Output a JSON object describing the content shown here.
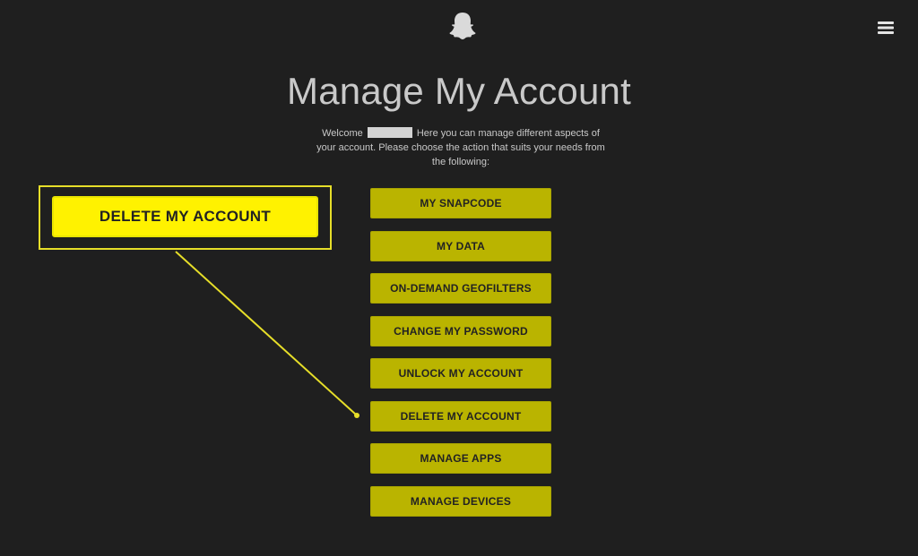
{
  "header": {
    "logo_icon": "snapchat-ghost-icon",
    "menu_icon": "hamburger-menu-icon"
  },
  "page": {
    "title": "Manage My Account",
    "welcome_prefix": "Welcome",
    "welcome_text": "Here you can manage different aspects of your account. Please choose the action that suits your needs from the following:"
  },
  "actions": [
    {
      "label": "MY SNAPCODE"
    },
    {
      "label": "MY DATA"
    },
    {
      "label": "ON-DEMAND GEOFILTERS"
    },
    {
      "label": "CHANGE MY PASSWORD"
    },
    {
      "label": "UNLOCK MY ACCOUNT"
    },
    {
      "label": "DELETE MY ACCOUNT"
    },
    {
      "label": "MANAGE APPS"
    },
    {
      "label": "MANAGE DEVICES"
    }
  ],
  "callout": {
    "label": "DELETE MY ACCOUNT"
  },
  "colors": {
    "background": "#1f1f1f",
    "button": "#bab400",
    "callout": "#fff200",
    "callout_line": "#e6de29",
    "title": "#c9c9c9"
  }
}
